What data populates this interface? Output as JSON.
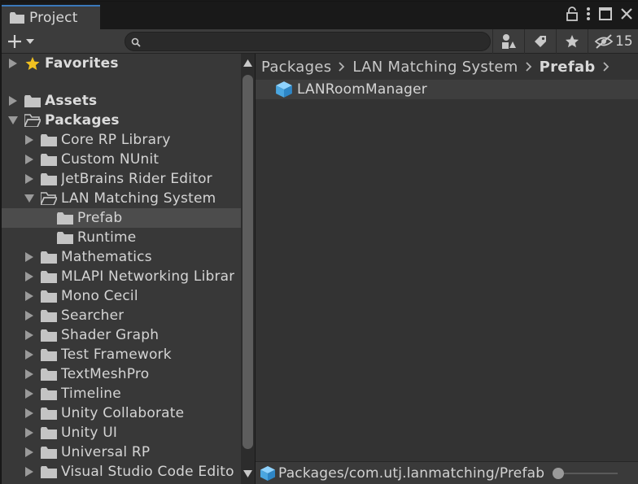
{
  "tab": {
    "label": "Project",
    "icon": "folder-icon"
  },
  "window_controls": [
    "lock-icon",
    "kebab-menu-icon",
    "maximize-icon",
    "close-icon"
  ],
  "toolbar": {
    "create_icon": "plus-icon",
    "search": {
      "value": "",
      "placeholder": ""
    },
    "hidden_count": "15"
  },
  "tree": {
    "items": [
      {
        "label": "Favorites",
        "level": 0,
        "expanded": false,
        "icon": "star-icon",
        "bold": true,
        "selected": false
      },
      {
        "label": "Assets",
        "level": 0,
        "expanded": false,
        "icon": "folder-icon",
        "bold": true,
        "selected": false
      },
      {
        "label": "Packages",
        "level": 0,
        "expanded": true,
        "icon": "folder-open-icon",
        "bold": true,
        "selected": false
      },
      {
        "label": "Core RP Library",
        "level": 1,
        "expanded": false,
        "icon": "folder-icon",
        "bold": false,
        "selected": false
      },
      {
        "label": "Custom NUnit",
        "level": 1,
        "expanded": false,
        "icon": "folder-icon",
        "bold": false,
        "selected": false
      },
      {
        "label": "JetBrains Rider Editor",
        "level": 1,
        "expanded": false,
        "icon": "folder-icon",
        "bold": false,
        "selected": false
      },
      {
        "label": "LAN Matching System",
        "level": 1,
        "expanded": true,
        "icon": "folder-open-icon",
        "bold": false,
        "selected": false
      },
      {
        "label": "Prefab",
        "level": 2,
        "leaf": true,
        "icon": "folder-icon",
        "bold": false,
        "selected": true
      },
      {
        "label": "Runtime",
        "level": 2,
        "leaf": true,
        "icon": "folder-icon",
        "bold": false,
        "selected": false
      },
      {
        "label": "Mathematics",
        "level": 1,
        "expanded": false,
        "icon": "folder-icon",
        "bold": false,
        "selected": false
      },
      {
        "label": "MLAPI Networking Librar",
        "level": 1,
        "expanded": false,
        "icon": "folder-icon",
        "bold": false,
        "selected": false
      },
      {
        "label": "Mono Cecil",
        "level": 1,
        "expanded": false,
        "icon": "folder-icon",
        "bold": false,
        "selected": false
      },
      {
        "label": "Searcher",
        "level": 1,
        "expanded": false,
        "icon": "folder-icon",
        "bold": false,
        "selected": false
      },
      {
        "label": "Shader Graph",
        "level": 1,
        "expanded": false,
        "icon": "folder-icon",
        "bold": false,
        "selected": false
      },
      {
        "label": "Test Framework",
        "level": 1,
        "expanded": false,
        "icon": "folder-icon",
        "bold": false,
        "selected": false
      },
      {
        "label": "TextMeshPro",
        "level": 1,
        "expanded": false,
        "icon": "folder-icon",
        "bold": false,
        "selected": false
      },
      {
        "label": "Timeline",
        "level": 1,
        "expanded": false,
        "icon": "folder-icon",
        "bold": false,
        "selected": false
      },
      {
        "label": "Unity Collaborate",
        "level": 1,
        "expanded": false,
        "icon": "folder-icon",
        "bold": false,
        "selected": false
      },
      {
        "label": "Unity UI",
        "level": 1,
        "expanded": false,
        "icon": "folder-icon",
        "bold": false,
        "selected": false
      },
      {
        "label": "Universal RP",
        "level": 1,
        "expanded": false,
        "icon": "folder-icon",
        "bold": false,
        "selected": false
      },
      {
        "label": "Visual Studio Code Edito",
        "level": 1,
        "expanded": false,
        "icon": "folder-icon",
        "bold": false,
        "selected": false
      }
    ]
  },
  "breadcrumb": {
    "items": [
      "Packages",
      "LAN Matching System",
      "Prefab"
    ],
    "current": "Prefab"
  },
  "assets": [
    {
      "label": "LANRoomManager",
      "icon": "prefab-cube-icon"
    }
  ],
  "status": {
    "path": "Packages/com.utj.lanmatching/Prefab",
    "icon": "prefab-cube-icon",
    "zoom_level": 0
  },
  "colors": {
    "accent": "#3a79bb",
    "prefab": "#5fb8f0",
    "favorite_star": "#f0c020"
  }
}
